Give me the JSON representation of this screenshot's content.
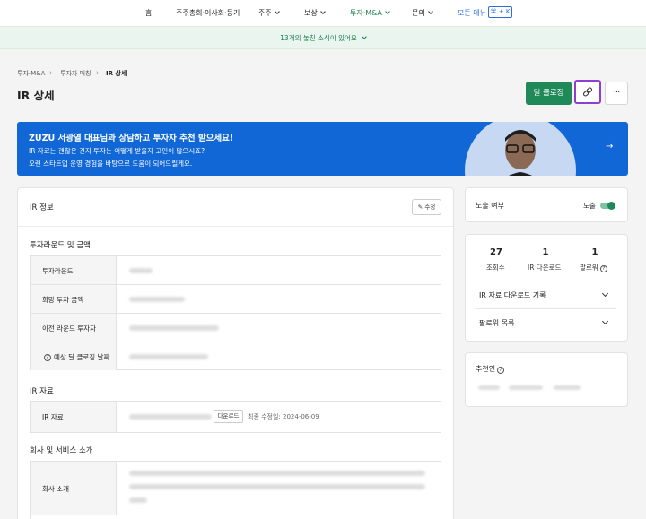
{
  "nav": {
    "items": [
      "홈",
      "주주총회·이사회·등기",
      "주주",
      "보상",
      "투자·M&A",
      "문의"
    ],
    "all_menu": "모든 메뉴",
    "shortcut": "⌘ + K"
  },
  "notice": "13개의 놓친 소식이 있어요",
  "breadcrumb": [
    "투자·M&A",
    "투자자 매칭",
    "IR 상세"
  ],
  "title": "IR 상세",
  "actions": {
    "deal_closing": "딜 클로징",
    "more": "···"
  },
  "banner": {
    "headline": "ZUZU 서광열 대표님과 상담하고 투자자 추천 받으세요!",
    "line1": "IR 자료는 괜찮은 건지 투자는 어떻게 받을지 고민이 많으시죠?",
    "line2": "오랜 스타트업 운영 경험을 바탕으로 도움이 되어드릴게요.",
    "arrow": "→"
  },
  "ir_info": {
    "title": "IR 정보",
    "edit": "수정",
    "section_round": "투자라운드 및 금액",
    "rows": [
      "투자라운드",
      "희망 투자 금액",
      "이전 라운드 투자자",
      "예상 딜 클로징 날짜"
    ],
    "section_docs": "IR 자료",
    "doc_label": "IR 자료",
    "download": "다운로드",
    "modified": "최종 수정일: 2024-06-09",
    "section_company": "회사 및 서비스 소개",
    "company_label": "회사 소개"
  },
  "exposure": {
    "label": "노출 여부",
    "state": "노출"
  },
  "stats": [
    {
      "value": "27",
      "label": "조회수"
    },
    {
      "value": "1",
      "label": "IR 다운로드"
    },
    {
      "value": "1",
      "label": "팔로워"
    }
  ],
  "accordion": [
    "IR 자료 다운로드 기록",
    "팔로워 목록"
  ],
  "recommender": {
    "title": "추천인"
  }
}
